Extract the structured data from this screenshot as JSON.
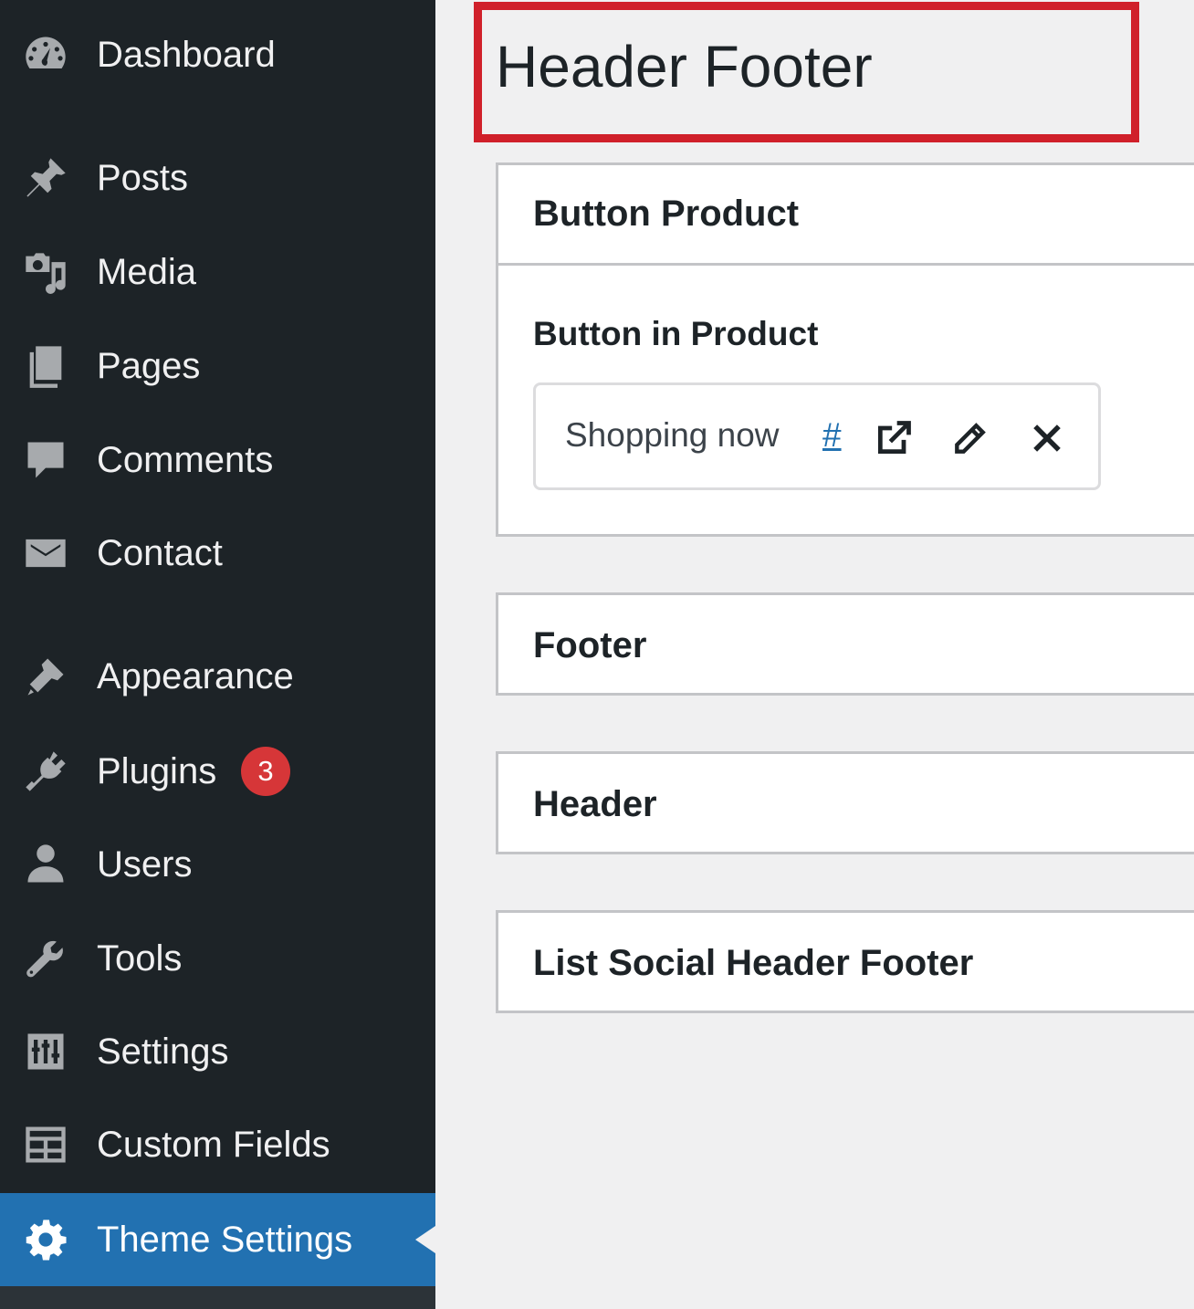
{
  "sidebar": {
    "items": [
      {
        "label": "Dashboard",
        "icon": "dashboard-icon"
      },
      {
        "label": "Posts",
        "icon": "pin-icon"
      },
      {
        "label": "Media",
        "icon": "media-icon"
      },
      {
        "label": "Pages",
        "icon": "pages-icon"
      },
      {
        "label": "Comments",
        "icon": "comment-icon"
      },
      {
        "label": "Contact",
        "icon": "envelope-icon"
      },
      {
        "label": "Appearance",
        "icon": "brush-icon"
      },
      {
        "label": "Plugins",
        "icon": "plugin-icon",
        "badge": "3"
      },
      {
        "label": "Users",
        "icon": "user-icon"
      },
      {
        "label": "Tools",
        "icon": "wrench-icon"
      },
      {
        "label": "Settings",
        "icon": "sliders-icon"
      },
      {
        "label": "Custom Fields",
        "icon": "table-icon"
      },
      {
        "label": "Theme Settings",
        "icon": "gear-icon",
        "active": true
      }
    ]
  },
  "main": {
    "page_title": "Header Footer",
    "panels": [
      {
        "title": "Button Product",
        "field_label": "Button in Product",
        "link": {
          "text": "Shopping now",
          "url": "#"
        }
      },
      {
        "title": "Footer"
      },
      {
        "title": "Header"
      },
      {
        "title": "List Social Header Footer"
      }
    ]
  },
  "colors": {
    "sidebar_bg": "#1d2327",
    "active_bg": "#2271b1",
    "badge_bg": "#d63638",
    "highlight_border": "#d0202a",
    "link": "#2271b1"
  }
}
